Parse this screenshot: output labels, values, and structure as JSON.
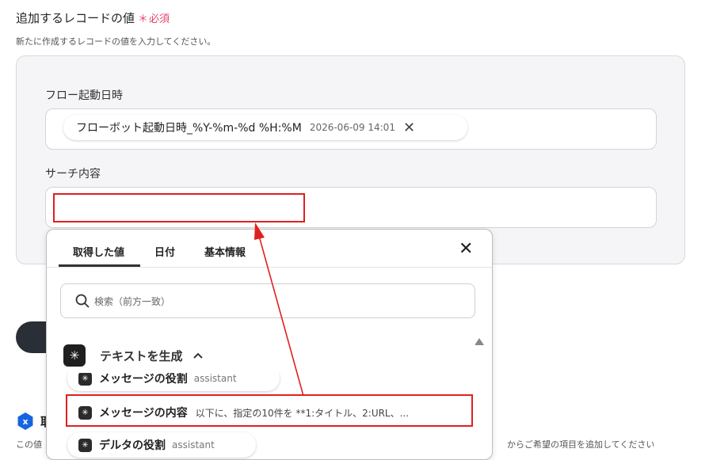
{
  "section": {
    "title": "追加するレコードの値",
    "required_mark": "＊",
    "required_label": "必須",
    "description": "新たに作成するレコードの値を入力してください。"
  },
  "fields": {
    "flow_start": {
      "label": "フロー起動日時",
      "chip_text": "フローボット起動日時_%Y-%m-%d %H:%M",
      "chip_date": "2026-06-09 14:01",
      "chip_remove": "✕"
    },
    "search": {
      "label": "サーチ内容",
      "value": ""
    }
  },
  "popup": {
    "tabs": [
      "取得した値",
      "日付",
      "基本情報"
    ],
    "active_tab": "取得した値",
    "close": "✕",
    "search_placeholder": "検索（前方一致）",
    "group": {
      "label": "テキストを生成",
      "chevron": "^"
    },
    "items": [
      {
        "name": "メッセージの役割",
        "preview": "assistant"
      },
      {
        "name": "メッセージの内容",
        "preview": "以下に、指定の10件を **1:タイトル、2:URL、..."
      },
      {
        "name": "デルタの役割",
        "preview": "assistant"
      }
    ]
  },
  "background": {
    "bottom_text": "からご希望の項目を追加してください",
    "left_text_start": "この値",
    "heading_start": "取"
  },
  "colors": {
    "accent_required": "#e5466c",
    "highlight_red": "#e02020",
    "brand_blue": "#1565e0"
  }
}
